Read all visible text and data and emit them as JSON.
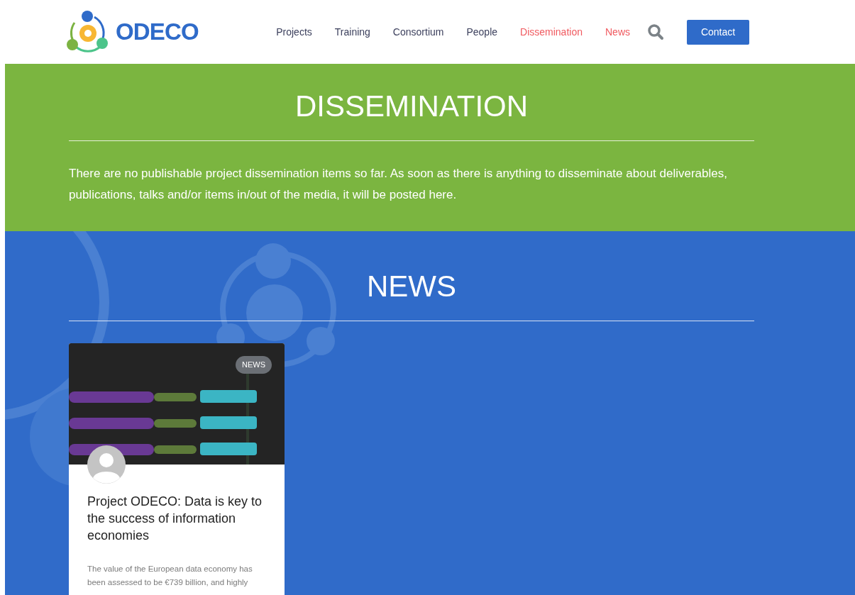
{
  "header": {
    "logo_text": "ODECO",
    "nav": [
      {
        "label": "Projects",
        "selected": false
      },
      {
        "label": "Training",
        "selected": false
      },
      {
        "label": "Consortium",
        "selected": false
      },
      {
        "label": "People",
        "selected": false
      },
      {
        "label": "Dissemination",
        "selected": true
      },
      {
        "label": "News",
        "selected": true
      }
    ],
    "contact_button": "Contact"
  },
  "dissemination": {
    "title": "DISSEMINATION",
    "text": "There are no publishable project dissemination items so far. As soon as there is anything to disseminate about deliverables, publications, talks and/or items in/out of the media, it will be posted here."
  },
  "news": {
    "title": "NEWS",
    "posts": [
      {
        "badge": "NEWS",
        "title": "Project ODECO: Data is key to the success of information economies",
        "excerpt": "The value of the European data economy has been assessed to be €739 billion, and highly"
      }
    ]
  }
}
